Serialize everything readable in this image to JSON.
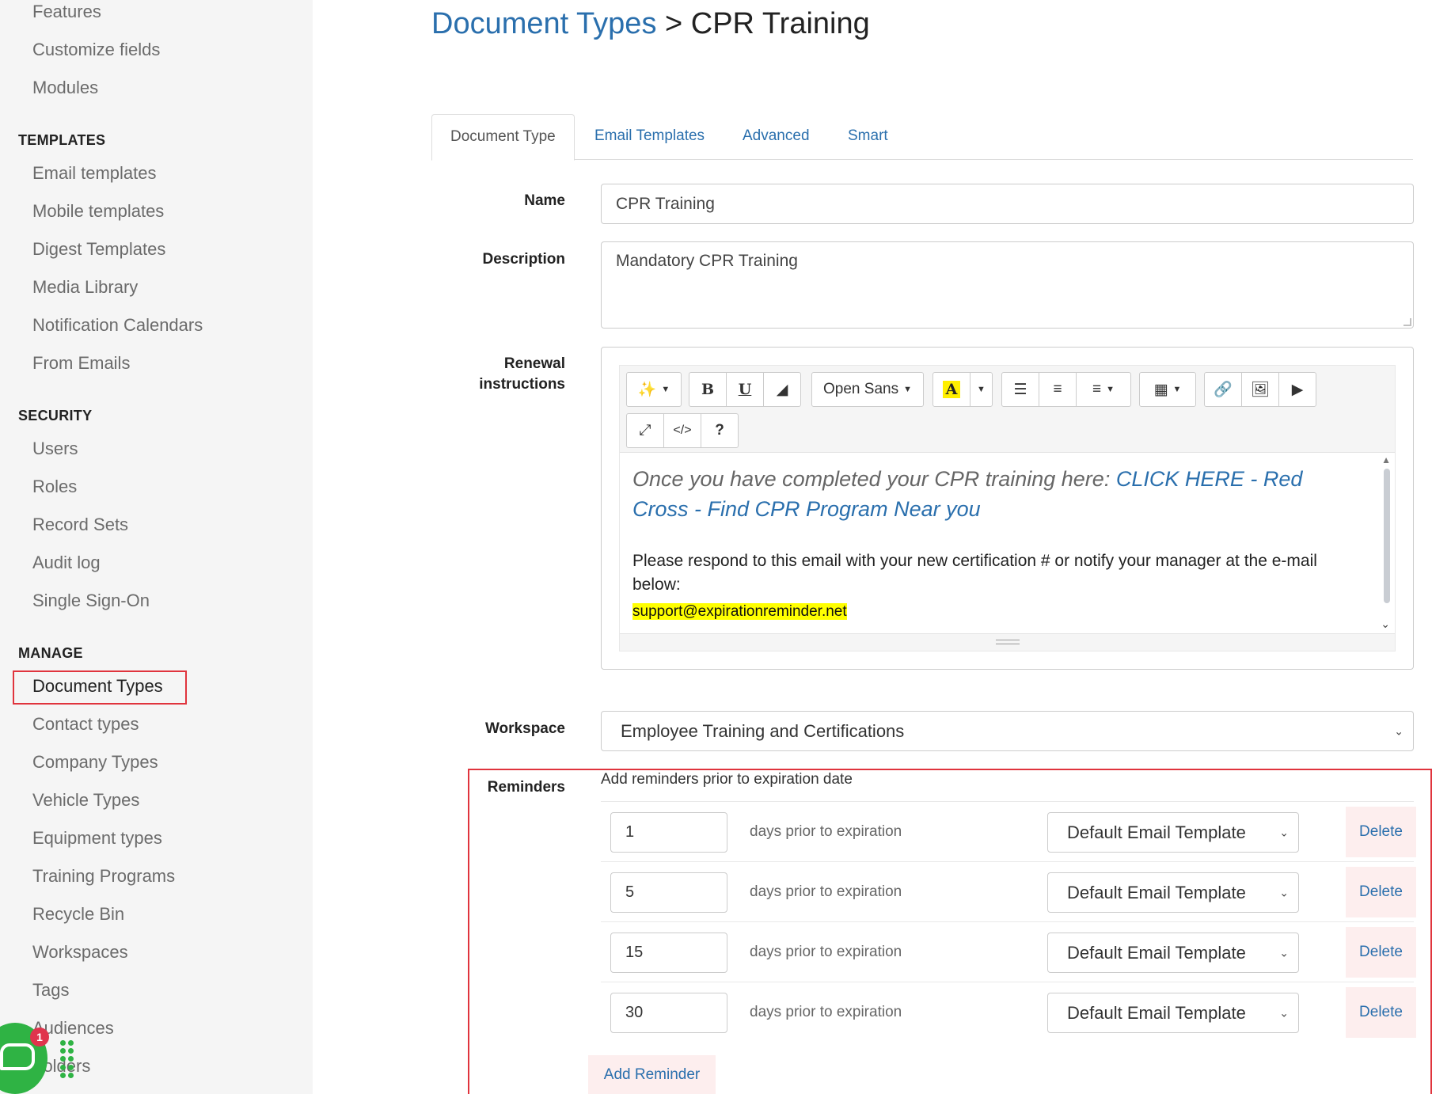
{
  "sidebar": {
    "top_items": [
      "Features",
      "Customize fields",
      "Modules"
    ],
    "sections": [
      {
        "heading": "TEMPLATES",
        "items": [
          "Email templates",
          "Mobile templates",
          "Digest Templates",
          "Media Library",
          "Notification Calendars",
          "From Emails"
        ]
      },
      {
        "heading": "SECURITY",
        "items": [
          "Users",
          "Roles",
          "Record Sets",
          "Audit log",
          "Single Sign-On"
        ]
      },
      {
        "heading": "MANAGE",
        "items": [
          "Document Types",
          "Contact types",
          "Company Types",
          "Vehicle Types",
          "Equipment types",
          "Training Programs",
          "Recycle Bin",
          "Workspaces",
          "Tags",
          "Audiences",
          "Folders"
        ]
      }
    ],
    "chat_badge": "1"
  },
  "header": {
    "crumb": "Document Types",
    "separator": " > ",
    "title": "CPR Training"
  },
  "tabs": [
    {
      "label": "Document Type",
      "active": true
    },
    {
      "label": "Email Templates",
      "active": false
    },
    {
      "label": "Advanced",
      "active": false
    },
    {
      "label": "Smart",
      "active": false
    }
  ],
  "form": {
    "name_label": "Name",
    "name_value": "CPR Training",
    "description_label": "Description",
    "description_value": "Mandatory CPR Training",
    "renewal_label_1": "Renewal",
    "renewal_label_2": "instructions",
    "workspace_label": "Workspace",
    "workspace_value": "Employee Training and Certifications"
  },
  "editor": {
    "font_name": "Open Sans",
    "line1_text": "Once you have completed your CPR training here: ",
    "line1_link": "CLICK HERE - Red Cross - Find CPR Program Near you",
    "line2": "Please respond to this email with your new certification # or notify your manager at the e-mail below:",
    "email": "support@expirationreminder.net"
  },
  "reminders": {
    "label": "Reminders",
    "subtitle": "Add reminders prior to expiration date",
    "suffix_text": "days prior to expiration",
    "template_value": "Default Email Template",
    "delete_label": "Delete",
    "add_label": "Add Reminder",
    "days": [
      "1",
      "5",
      "15",
      "30"
    ]
  }
}
